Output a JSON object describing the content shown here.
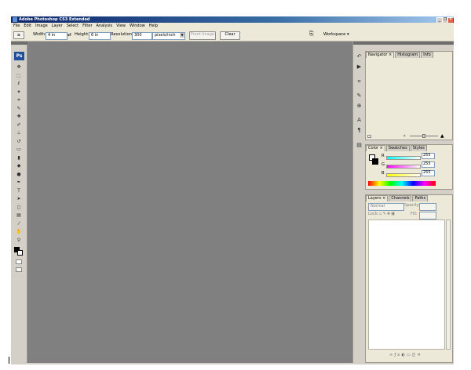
{
  "window": {
    "title": "Adobe Photoshop CS3 Extended",
    "controls": [
      "_",
      "❐",
      "✕"
    ]
  },
  "menu": [
    "File",
    "Edit",
    "Image",
    "Layer",
    "Select",
    "Filter",
    "Analysis",
    "View",
    "Window",
    "Help"
  ],
  "options": {
    "width_label": "Width:",
    "width_value": "4 in",
    "height_label": "Height:",
    "height_value": "6 in",
    "resolution_label": "Resolution:",
    "resolution_value": "300",
    "resolution_unit": "pixels/inch",
    "front_image_label": "Front Image",
    "clear_label": "Clear",
    "workspace_label": "Workspace ▾"
  },
  "tools": {
    "ps_logo": "Ps",
    "items": [
      {
        "name": "move",
        "glyph": "✥"
      },
      {
        "name": "marquee",
        "glyph": "⬚"
      },
      {
        "name": "lasso",
        "glyph": "ℓ"
      },
      {
        "name": "magic-wand",
        "glyph": "✦"
      },
      {
        "name": "crop",
        "glyph": "⌗"
      },
      {
        "name": "slice",
        "glyph": "✎"
      },
      {
        "name": "healing",
        "glyph": "✚"
      },
      {
        "name": "brush",
        "glyph": "✐"
      },
      {
        "name": "stamp",
        "glyph": "⊥"
      },
      {
        "name": "history-brush",
        "glyph": "↺"
      },
      {
        "name": "eraser",
        "glyph": "▭"
      },
      {
        "name": "gradient",
        "glyph": "▮"
      },
      {
        "name": "blur",
        "glyph": "◆"
      },
      {
        "name": "dodge",
        "glyph": "●"
      },
      {
        "name": "pen",
        "glyph": "✒"
      },
      {
        "name": "type",
        "glyph": "T"
      },
      {
        "name": "path-select",
        "glyph": "➤"
      },
      {
        "name": "shape",
        "glyph": "◻"
      },
      {
        "name": "notes",
        "glyph": "▤"
      },
      {
        "name": "eyedropper",
        "glyph": "⁄"
      },
      {
        "name": "hand",
        "glyph": "✋"
      },
      {
        "name": "zoom",
        "glyph": "⚲"
      }
    ]
  },
  "dock": {
    "icons": [
      "history",
      "actions",
      "tool-presets",
      "brushes",
      "clone-source",
      "character",
      "paragraph",
      "layer-comps"
    ]
  },
  "navigator": {
    "tabs": [
      "Navigator ×",
      "Histogram",
      "Info"
    ]
  },
  "color": {
    "tabs": [
      "Color ×",
      "Swatches",
      "Styles"
    ],
    "channels": [
      {
        "label": "R",
        "value": "255",
        "color": "#e05050"
      },
      {
        "label": "G",
        "value": "255",
        "color": "#50c050"
      },
      {
        "label": "B",
        "value": "255",
        "color": "#5050e0"
      }
    ]
  },
  "layers": {
    "tabs": [
      "Layers ×",
      "Channels",
      "Paths"
    ],
    "blend_mode": "Normal",
    "opacity_label": "Opacity:",
    "lock_label": "Lock:",
    "fill_label": "Fill:"
  }
}
